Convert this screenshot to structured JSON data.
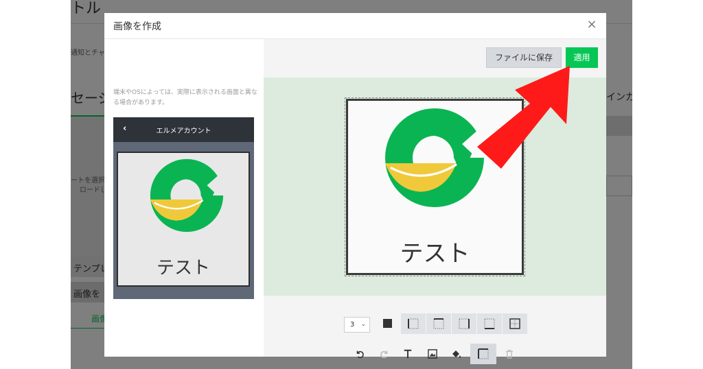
{
  "background": {
    "title_partial": "トル",
    "hint_partial": "通知とチャ",
    "message_partial": "セージ",
    "right_partial": "インガー",
    "upload_partial_1": "ートを選択",
    "upload_partial_2": "ロードし",
    "template_partial": "テンプレ",
    "image_partial": "画像を",
    "image_link_partial": "画像"
  },
  "modal": {
    "title": "画像を作成",
    "close_symbol": "×"
  },
  "left": {
    "note": "端末やOSによっては、実際に表示される画面と異なる場合があります。",
    "phone": {
      "back": "‹",
      "title": "エルメアカウント",
      "card_text": "テスト"
    }
  },
  "right": {
    "save_label": "ファイルに保存",
    "apply_label": "適用",
    "canvas_text": "テスト"
  },
  "toolbar1": {
    "size_value": "3",
    "size_chevron": "⌄"
  },
  "colors": {
    "logo_green": "#0bb453",
    "logo_yellow": "#f0c93a",
    "apply_green": "#06c755",
    "arrow_red": "#ff1a1a",
    "canvas_bg": "#dcebdd"
  },
  "icons": [
    "undo-icon",
    "redo-icon",
    "text-icon",
    "image-icon",
    "fill-icon",
    "border-icon",
    "trash-icon"
  ]
}
